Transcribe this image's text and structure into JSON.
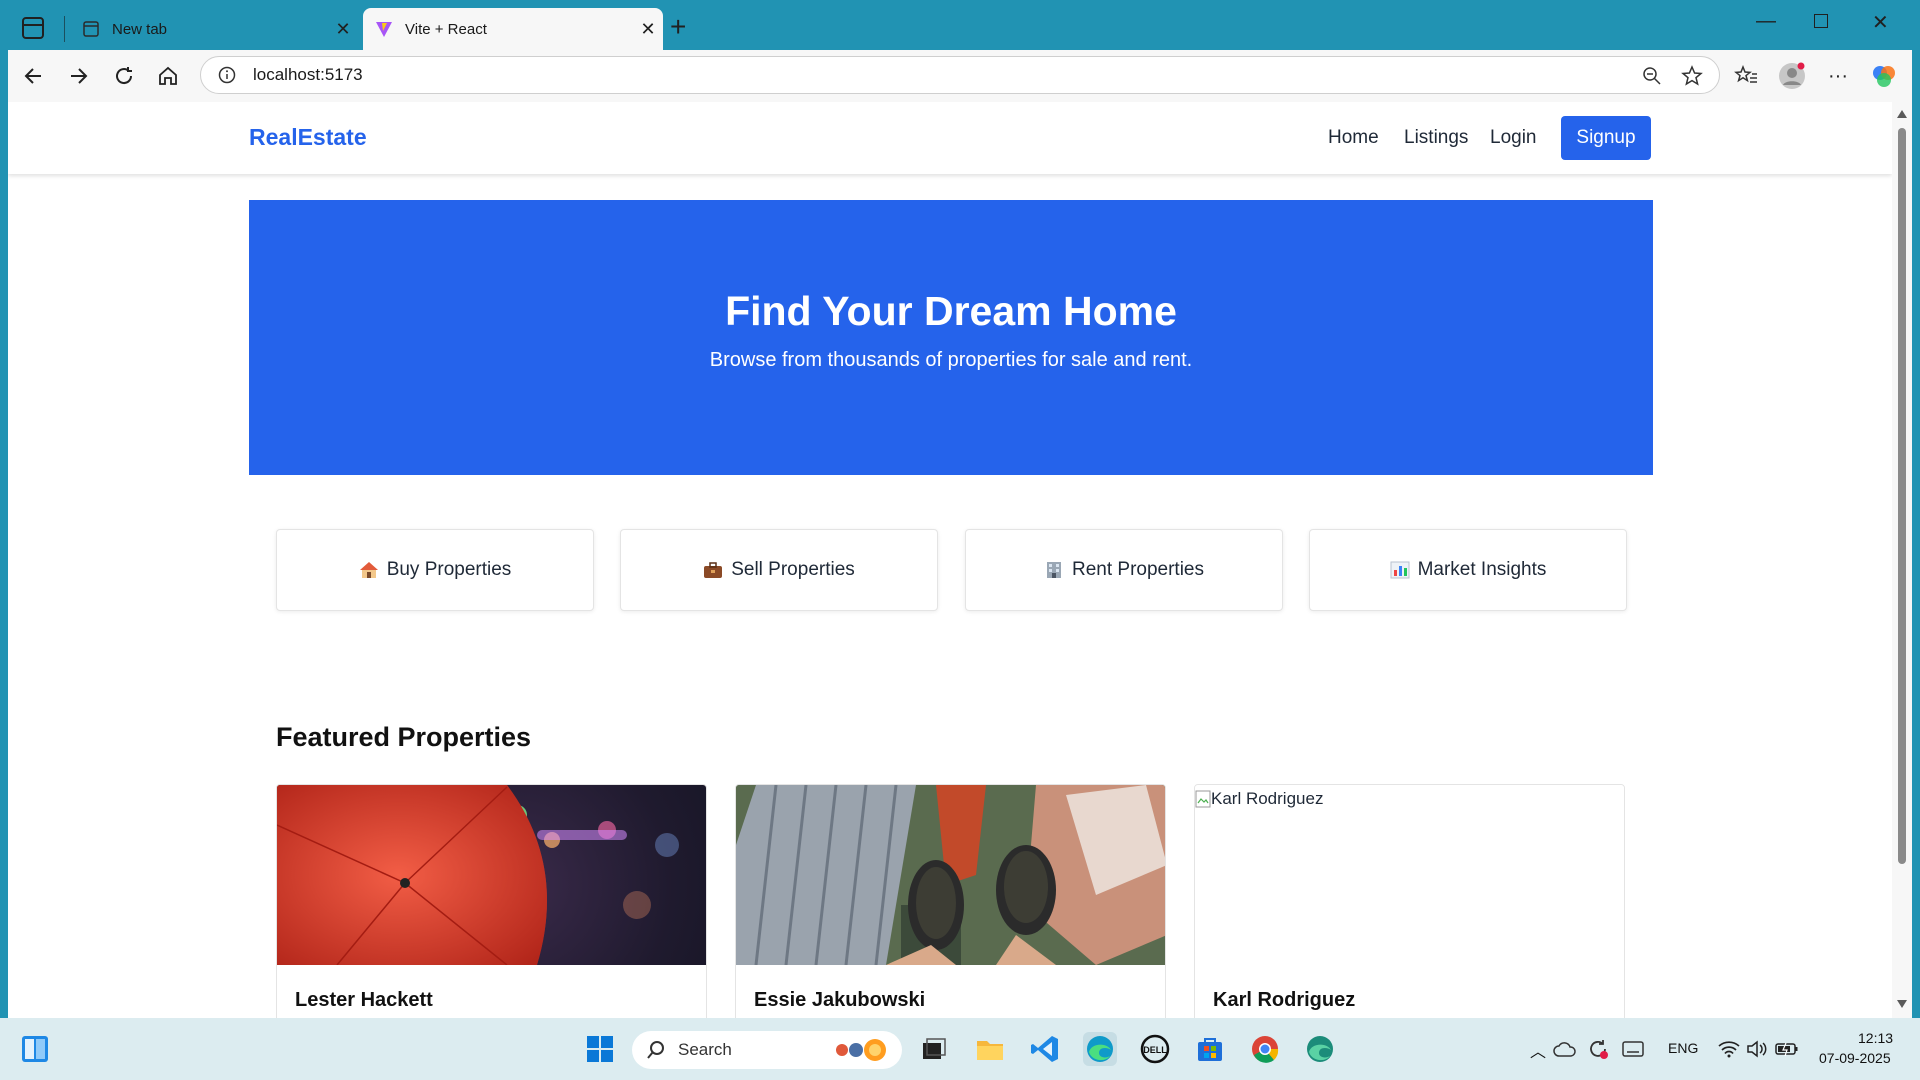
{
  "browser": {
    "tabs": [
      {
        "title": "New tab",
        "active": false
      },
      {
        "title": "Vite + React",
        "active": true
      }
    ],
    "url": "localhost:5173"
  },
  "site": {
    "logo": "RealEstate",
    "nav": {
      "home": "Home",
      "listings": "Listings",
      "login": "Login",
      "signup": "Signup"
    },
    "hero": {
      "title": "Find Your Dream Home",
      "subtitle": "Browse from thousands of properties for sale and rent."
    },
    "categories": [
      {
        "label": "Buy Properties",
        "icon": "house-icon"
      },
      {
        "label": "Sell Properties",
        "icon": "briefcase-icon"
      },
      {
        "label": "Rent Properties",
        "icon": "office-building-icon"
      },
      {
        "label": "Market Insights",
        "icon": "bar-chart-icon"
      }
    ],
    "featured_title": "Featured Properties",
    "properties": [
      {
        "name": "Lester Hackett",
        "image": "red-umbrella-photo"
      },
      {
        "name": "Essie Jakubowski",
        "image": "feet-over-skyscraper-photo"
      },
      {
        "name": "Karl Rodriguez",
        "image_alt": "Karl Rodriguez",
        "image": "broken-image"
      }
    ]
  },
  "taskbar": {
    "search_label": "Search",
    "language": "ENG",
    "time": "12:13",
    "date": "07-09-2025"
  },
  "colors": {
    "brand": "#2563eb",
    "chrome": "#2193b3",
    "taskbar": "#dcecf0"
  }
}
